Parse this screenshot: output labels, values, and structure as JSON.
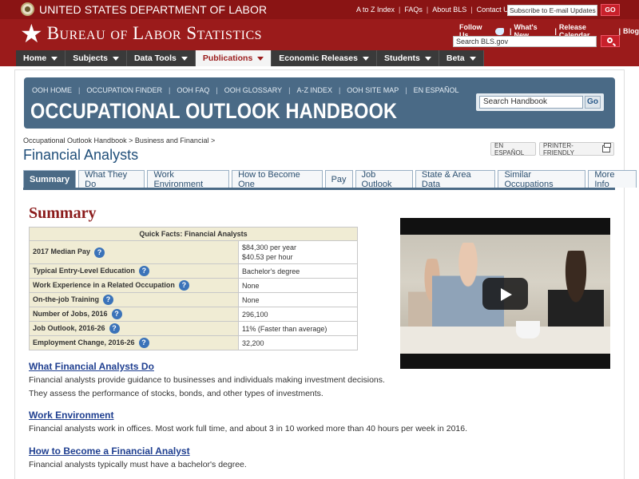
{
  "header": {
    "dol_title": "United States Department of Labor",
    "toplinks": [
      "A to Z Index",
      "FAQs",
      "About BLS",
      "Contact Us"
    ],
    "email_placeholder": "Subscribe to E-mail Updates",
    "go_label": "GO",
    "bls_name": "Bureau of Labor Statistics",
    "follow_us": "Follow Us",
    "whats_new": "What's New",
    "release_calendar": "Release Calendar",
    "blog": "Blog",
    "search_placeholder": "Search BLS.gov"
  },
  "nav": {
    "items": [
      {
        "label": "Home"
      },
      {
        "label": "Subjects"
      },
      {
        "label": "Data Tools"
      },
      {
        "label": "Publications"
      },
      {
        "label": "Economic Releases"
      },
      {
        "label": "Students"
      },
      {
        "label": "Beta"
      }
    ],
    "active": "Publications"
  },
  "ooh": {
    "links": [
      "OOH HOME",
      "OCCUPATION FINDER",
      "OOH FAQ",
      "OOH GLOSSARY",
      "A-Z INDEX",
      "OOH SITE MAP",
      "EN ESPAÑOL"
    ],
    "title": "OCCUPATIONAL OUTLOOK HANDBOOK",
    "search_value": "Search Handbook",
    "go_label": "Go"
  },
  "breadcrumb": {
    "first": "Occupational Outlook Handbook",
    "second": "Business and Financial",
    "sep": ">"
  },
  "page": {
    "title": "Financial Analysts",
    "en_espanol": "EN ESPAÑOL",
    "printer_friendly": "PRINTER-FRIENDLY"
  },
  "tabs": [
    "Summary",
    "What They Do",
    "Work Environment",
    "How to Become One",
    "Pay",
    "Job Outlook",
    "State & Area Data",
    "Similar Occupations",
    "More Info"
  ],
  "summary": {
    "heading": "Summary",
    "table_title": "Quick Facts: Financial Analysts",
    "rows": [
      {
        "key": "2017 Median Pay",
        "value": "$84,300 per year",
        "value2": "$40.53 per hour"
      },
      {
        "key": "Typical Entry-Level Education",
        "value": "Bachelor's degree"
      },
      {
        "key": "Work Experience in a Related Occupation",
        "value": "None"
      },
      {
        "key": "On-the-job Training",
        "value": "None"
      },
      {
        "key": "Number of Jobs, 2016",
        "value": "296,100"
      },
      {
        "key": "Job Outlook, 2016-26",
        "value": "11% (Faster than average)"
      },
      {
        "key": "Employment Change, 2016-26",
        "value": "32,200"
      }
    ],
    "help_glyph": "?"
  },
  "sections": [
    {
      "heading": "What Financial Analysts Do",
      "text": "Financial analysts provide guidance to businesses and individuals making investment decisions. They assess the performance of stocks, bonds, and other types of investments."
    },
    {
      "heading": "Work Environment",
      "text": "Financial analysts work in offices. Most work full time, and about 3 in 10 worked more than 40 hours per week in 2016."
    },
    {
      "heading": "How to Become a Financial Analyst",
      "text": "Financial analysts typically must have a bachelor's degree."
    }
  ],
  "colors": {
    "bls_red": "#9b1b1b",
    "ooh_blue": "#4a6a86",
    "summary_red": "#8b1c1c",
    "link_blue": "#1f3f90",
    "table_tan": "#f0ecd4",
    "help_blue": "#3b73b9"
  },
  "icons": [
    "dol-seal-icon",
    "bls-star-icon",
    "twitter-bird-icon",
    "search-icon",
    "caret-down-icon",
    "help-icon",
    "printer-icon",
    "play-icon"
  ]
}
